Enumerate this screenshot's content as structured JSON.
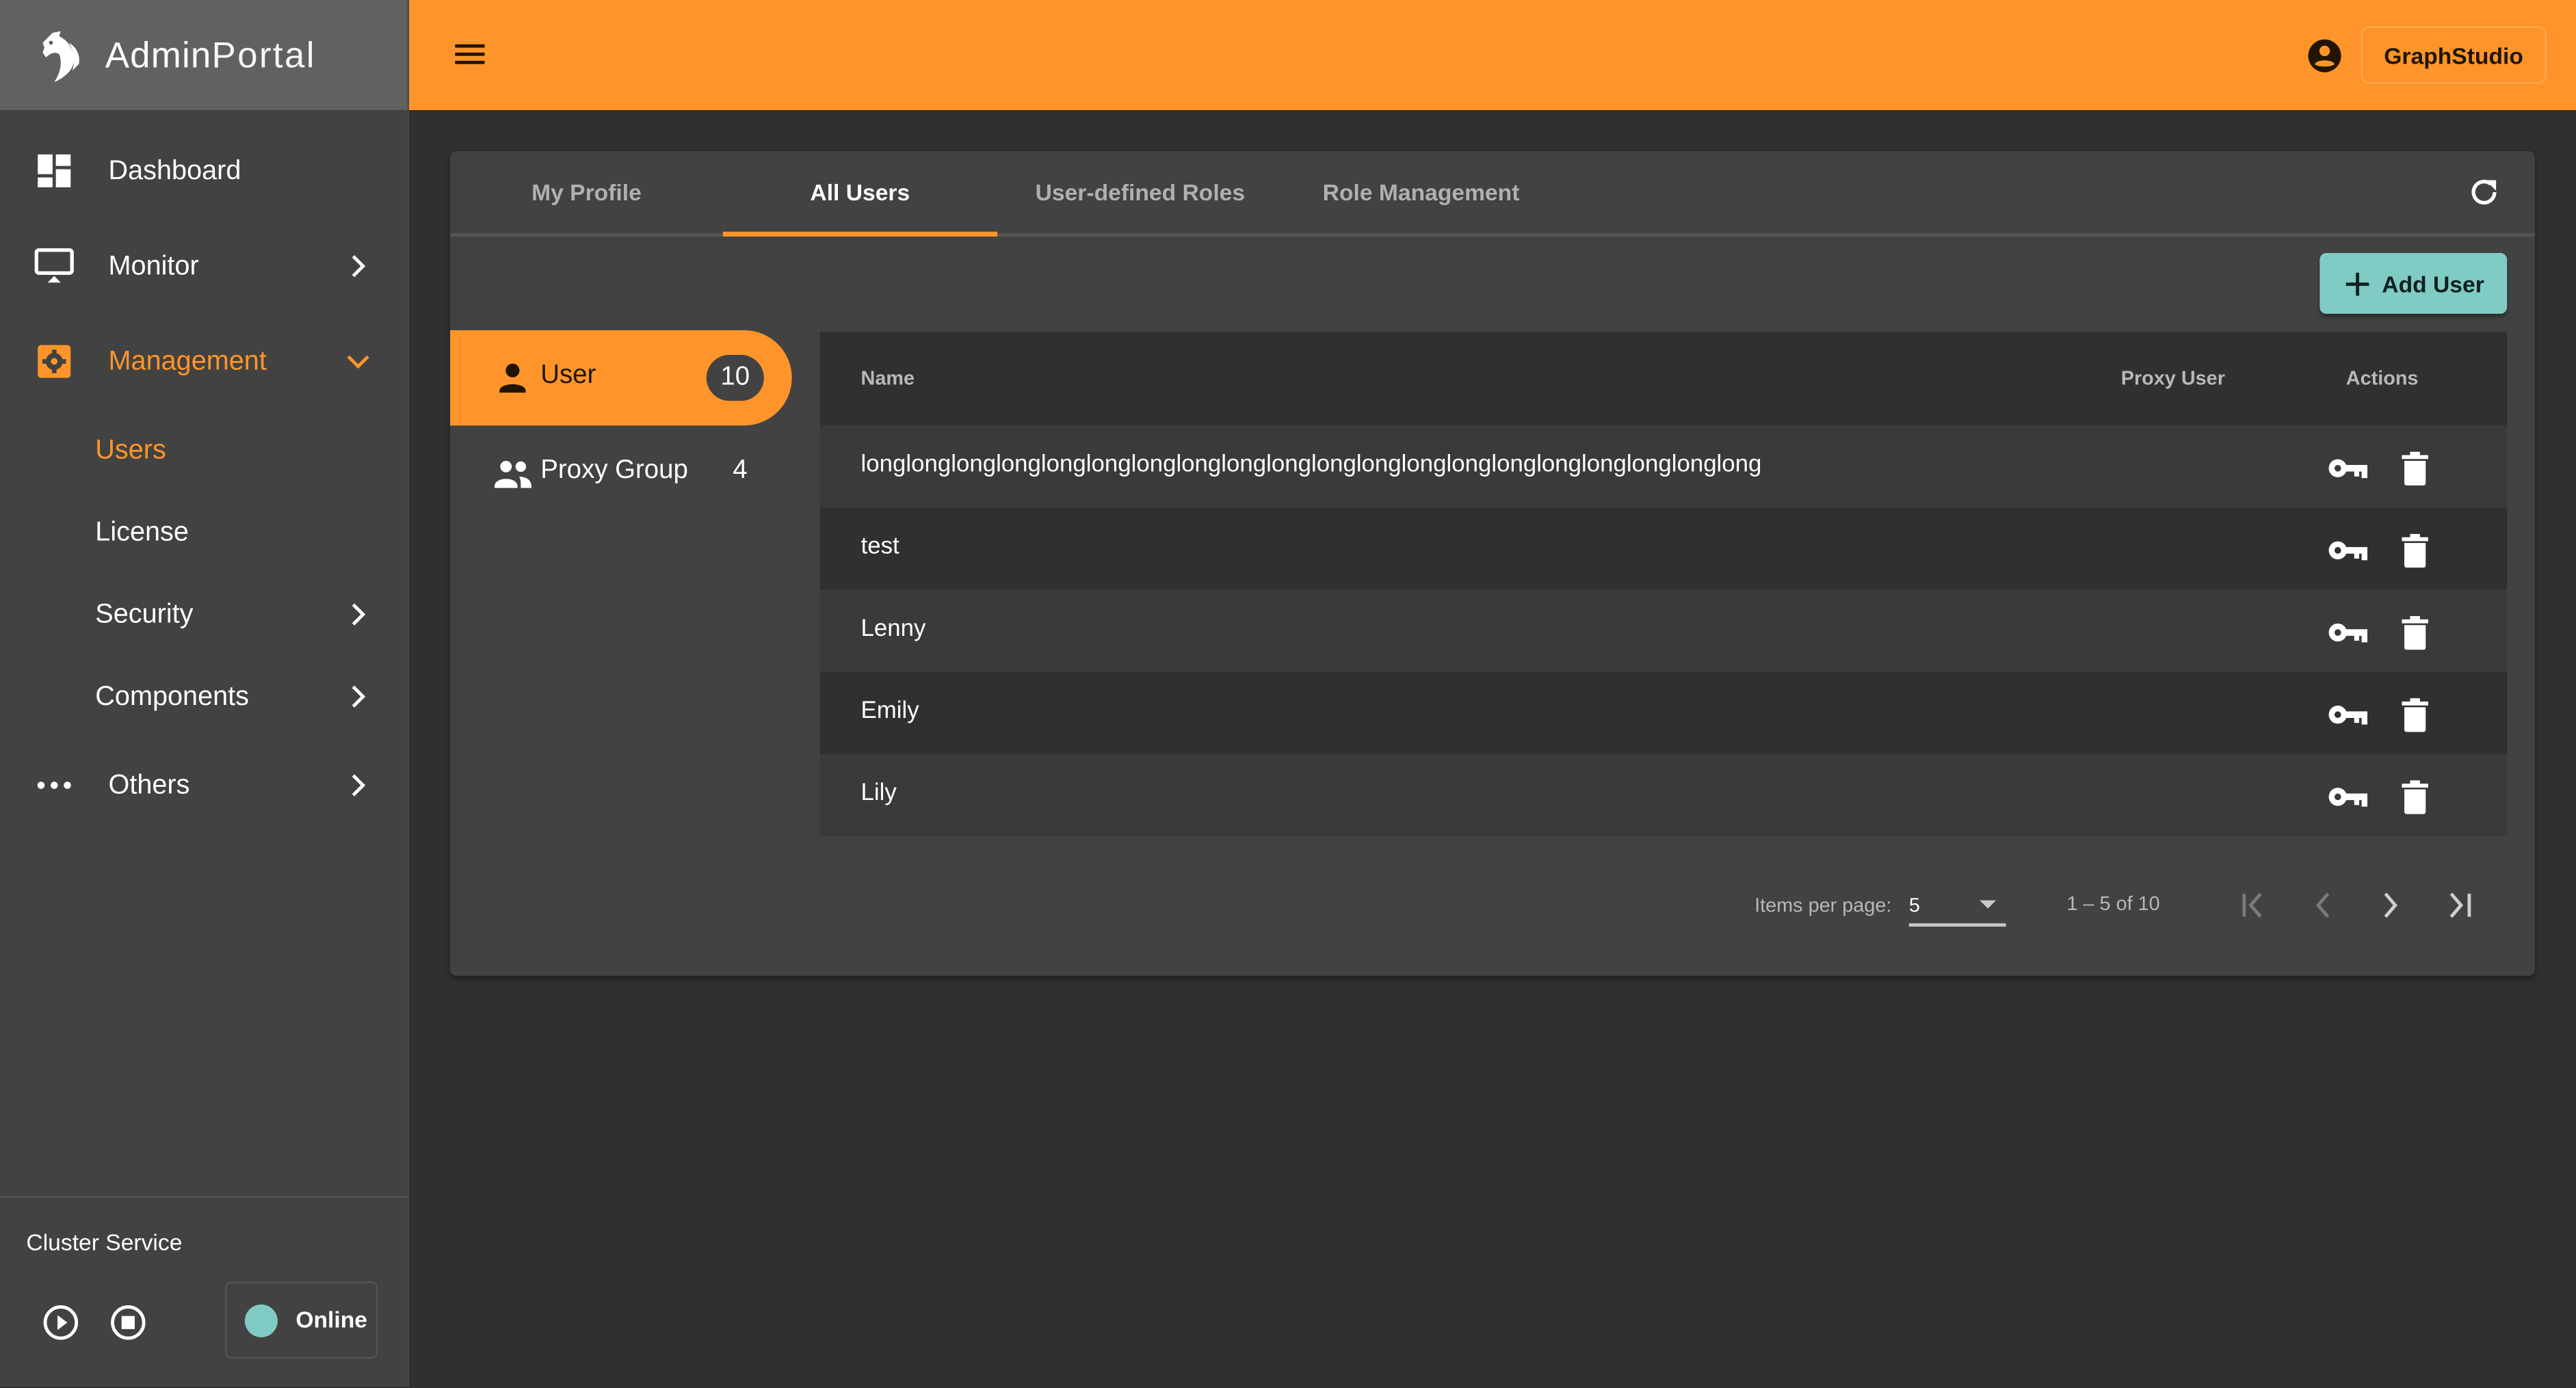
{
  "brand": {
    "name_bold": "Admin",
    "name_light": "Portal"
  },
  "sidebar": {
    "items": [
      {
        "label": "Dashboard",
        "icon": "dashboard-icon"
      },
      {
        "label": "Monitor",
        "icon": "monitor-icon"
      },
      {
        "label": "Management",
        "icon": "settings-box-icon",
        "expanded": true
      }
    ],
    "sub_items": [
      {
        "label": "Users",
        "active": true
      },
      {
        "label": "License"
      },
      {
        "label": "Security"
      },
      {
        "label": "Components"
      }
    ],
    "others": {
      "label": "Others",
      "icon": "more-horiz-icon"
    },
    "cluster": {
      "title": "Cluster Service",
      "status": "Online",
      "status_color": "#80cbc4"
    }
  },
  "header": {
    "app_button": "GraphStudio",
    "accent_color": "#ff952a"
  },
  "tabs": [
    {
      "label": "My Profile"
    },
    {
      "label": "All Users",
      "active": true
    },
    {
      "label": "User-defined Roles"
    },
    {
      "label": "Role Management"
    }
  ],
  "toolbar": {
    "add_user_label": "Add User"
  },
  "categories": [
    {
      "label": "User",
      "count": "10",
      "active": true
    },
    {
      "label": "Proxy Group",
      "count": "4"
    }
  ],
  "table": {
    "columns": {
      "name": "Name",
      "proxy_user": "Proxy User",
      "actions": "Actions"
    },
    "rows": [
      {
        "name": "longlonglonglonglonglonglonglonglonglonglonglonglonglonglonglonglonglonglonglong",
        "proxy_user": ""
      },
      {
        "name": "test",
        "proxy_user": ""
      },
      {
        "name": "Lenny",
        "proxy_user": ""
      },
      {
        "name": "Emily",
        "proxy_user": ""
      },
      {
        "name": "Lily",
        "proxy_user": ""
      }
    ]
  },
  "paginator": {
    "items_per_page_label": "Items per page:",
    "items_per_page": "5",
    "range": "1 – 5 of 10"
  }
}
